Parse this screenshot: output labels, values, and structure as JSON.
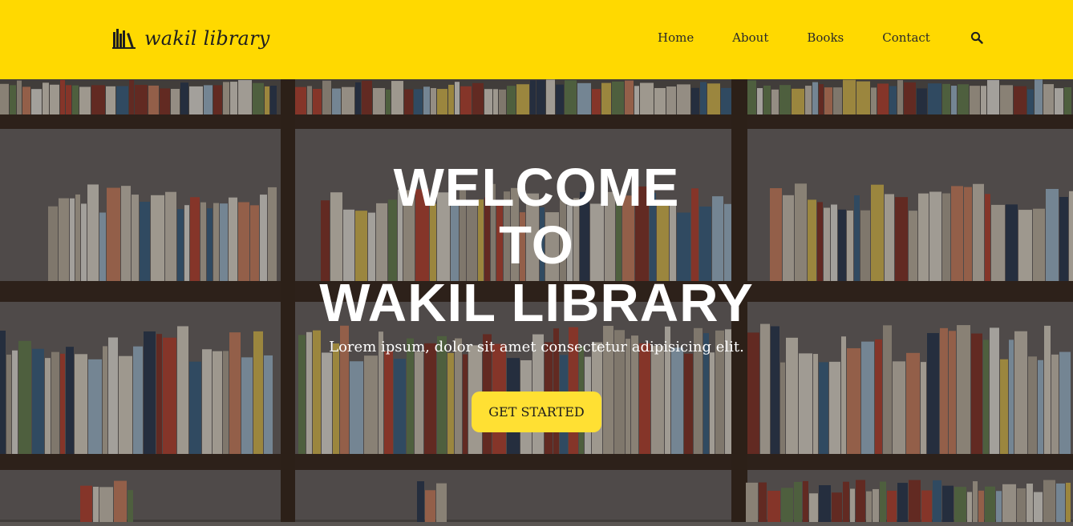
{
  "header": {
    "logo_text": "wakil library",
    "nav": [
      {
        "label": "Home"
      },
      {
        "label": "About"
      },
      {
        "label": "Books"
      },
      {
        "label": "Contact"
      }
    ],
    "icons": {
      "logo": "books-icon",
      "search": "search-icon"
    }
  },
  "hero": {
    "title_line1": "WELCOME",
    "title_line2": "TO",
    "title_line3": "WAKIL LIBRARY",
    "subtitle": "Lorem ipsum, dolor sit amet consectetur adipisicing elit.",
    "cta_label": "GET STARTED"
  },
  "colors": {
    "brand_yellow": "#ffd900",
    "button_yellow": "#ffe033",
    "text_dark": "#1f1f1f",
    "hero_text": "#ffffff"
  }
}
